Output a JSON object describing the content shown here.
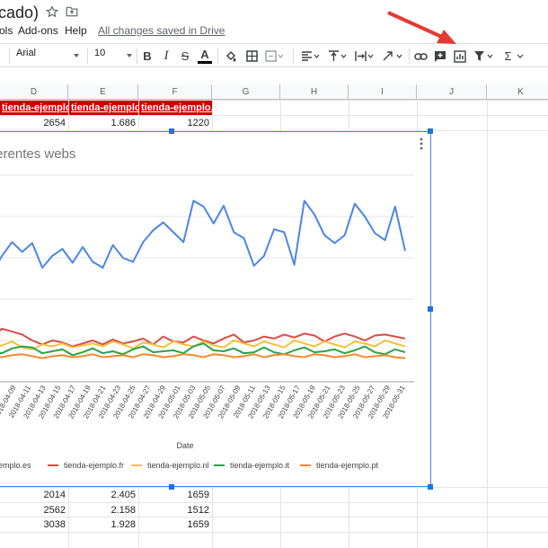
{
  "title": {
    "doc_name": "icado)"
  },
  "menu": {
    "tools_fragment": "ols",
    "addons": "Add-ons",
    "help": "Help",
    "saved_status": "All changes saved in Drive"
  },
  "toolbar": {
    "font": "Arial",
    "font_size": "10",
    "bold": "B",
    "italic": "I",
    "strike": "S",
    "text_color": "A",
    "sum": "Σ"
  },
  "columns": [
    "D",
    "E",
    "F",
    "G",
    "H",
    "I",
    "J",
    "K"
  ],
  "header_row": {
    "d": "tienda-ejemplo.nl",
    "e": "tienda-ejemplo.it",
    "f": "tienda-ejemplo.pt"
  },
  "row_top": {
    "d": "2654",
    "e": "1.686",
    "f": "1220"
  },
  "rows_bottom": [
    {
      "d": "2014",
      "e": "2.405",
      "f": "1659"
    },
    {
      "d": "2562",
      "e": "2.158",
      "f": "1512"
    },
    {
      "d": "3038",
      "e": "1.928",
      "f": "1659"
    }
  ],
  "chart": {
    "title_fragment": "ferentes webs",
    "xlabel": "Date",
    "legend": [
      {
        "name": "ejemplo.es",
        "color": "#4a86e8"
      },
      {
        "name": "tienda-ejemplo.fr",
        "color": "#dd4b45"
      },
      {
        "name": "tienda-ejemplo.nl",
        "color": "#f1c232"
      },
      {
        "name": "tienda-ejemplo.it",
        "color": "#2ba24c"
      },
      {
        "name": "tienda-ejemplo.pt",
        "color": "#f48a2a"
      }
    ]
  },
  "chart_data": {
    "type": "line",
    "title": "",
    "xlabel": "Date",
    "ylabel": "",
    "x": [
      "2018-04-07",
      "2018-04-09",
      "2018-04-11",
      "2018-04-13",
      "2018-04-15",
      "2018-04-17",
      "2018-04-19",
      "2018-04-21",
      "2018-04-23",
      "2018-04-25",
      "2018-04-27",
      "2018-04-29",
      "2018-05-01",
      "2018-05-03",
      "2018-05-05",
      "2018-05-07",
      "2018-05-09",
      "2018-05-11",
      "2018-05-13",
      "2018-05-15",
      "2018-05-17",
      "2018-05-19",
      "2018-05-21",
      "2018-05-23",
      "2018-05-25",
      "2018-05-27",
      "2018-05-29",
      "2018-05-31"
    ],
    "series": [
      {
        "name": "ejemplo.es",
        "values": [
          2700,
          2880,
          3020,
          2920,
          3010,
          2760,
          2880,
          2950,
          2810,
          2970,
          2820,
          2760,
          2990,
          2860,
          2820,
          3020,
          3140,
          3220,
          3120,
          3020,
          3440,
          3380,
          3210,
          3390,
          3120,
          3060,
          2780,
          2880,
          3150,
          3120,
          2790,
          3440,
          3300,
          3090,
          3010,
          3090,
          3410,
          3280,
          3110,
          3040,
          3380,
          2930
        ]
      },
      {
        "name": "tienda-ejemplo.fr",
        "values": [
          2050,
          2140,
          2110,
          2080,
          2020,
          1980,
          2020,
          2000,
          1960,
          1990,
          2020,
          1980,
          2030,
          1990,
          2010,
          2040,
          1980,
          2060,
          2010,
          2000,
          2060,
          2020,
          1990,
          2040,
          2080,
          2000,
          2020,
          2060,
          2040,
          2080,
          2050,
          2090,
          2070,
          2010,
          2060,
          2090,
          2060,
          2020,
          2070,
          2080,
          2060,
          2040
        ]
      },
      {
        "name": "tienda-ejemplo.nl",
        "values": [
          1930,
          1970,
          2010,
          1950,
          1930,
          1980,
          1960,
          1990,
          1950,
          1970,
          1990,
          1960,
          2010,
          1980,
          1940,
          2000,
          1980,
          1950,
          2010,
          1980,
          1960,
          2010,
          1970,
          1950,
          2020,
          1990,
          1960,
          2010,
          1980,
          1950,
          2020,
          1990,
          1960,
          2010,
          1980,
          1950,
          2010,
          1990,
          1960,
          2020,
          1990,
          1960
        ]
      },
      {
        "name": "tienda-ejemplo.it",
        "values": [
          1900,
          1890,
          1940,
          1960,
          1950,
          1890,
          1910,
          1930,
          1870,
          1900,
          1940,
          1890,
          1910,
          1880,
          1930,
          1960,
          1900,
          1910,
          1920,
          1890,
          1960,
          1990,
          1920,
          1910,
          1940,
          1890,
          1900,
          1950,
          1900,
          1880,
          1920,
          1950,
          1900,
          1910,
          1930,
          1890,
          1920,
          1960,
          1900,
          1880,
          1930,
          1900
        ]
      },
      {
        "name": "tienda-ejemplo.pt",
        "values": [
          1860,
          1850,
          1870,
          1880,
          1860,
          1840,
          1860,
          1870,
          1850,
          1860,
          1880,
          1850,
          1860,
          1870,
          1850,
          1880,
          1870,
          1850,
          1860,
          1880,
          1870,
          1850,
          1880,
          1870,
          1850,
          1860,
          1880,
          1850,
          1870,
          1880,
          1860,
          1850,
          1880,
          1870,
          1850,
          1860,
          1880,
          1850,
          1860,
          1870,
          1850,
          1840
        ]
      }
    ],
    "ylim": [
      1600,
      3700
    ],
    "grid": true,
    "legend": "bottom"
  }
}
